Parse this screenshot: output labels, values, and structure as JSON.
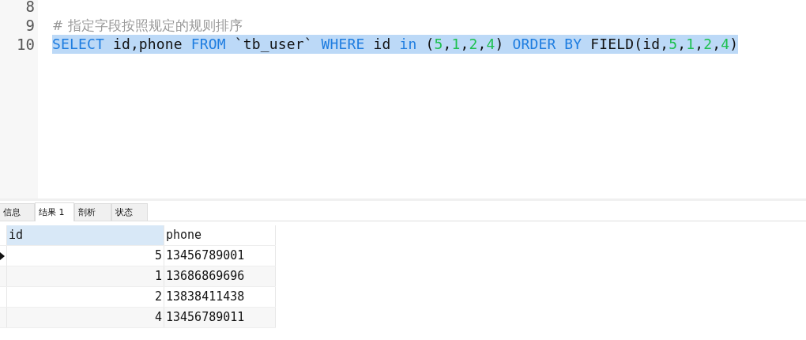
{
  "editor": {
    "lines": [
      {
        "number": "8",
        "selected": false
      },
      {
        "number": "9",
        "selected": false,
        "tokens": [
          {
            "kind": "comment",
            "text": "# 指定字段按照规定的规则排序"
          }
        ]
      },
      {
        "number": "10",
        "selected": true,
        "tokens": [
          {
            "kind": "keyword",
            "text": "SELECT"
          },
          {
            "kind": "plain",
            "text": " id,phone "
          },
          {
            "kind": "keyword",
            "text": "FROM"
          },
          {
            "kind": "plain",
            "text": " `tb_user` "
          },
          {
            "kind": "keyword",
            "text": "WHERE"
          },
          {
            "kind": "plain",
            "text": " id "
          },
          {
            "kind": "keyword",
            "text": "in"
          },
          {
            "kind": "plain",
            "text": " ("
          },
          {
            "kind": "number",
            "text": "5"
          },
          {
            "kind": "plain",
            "text": ","
          },
          {
            "kind": "number",
            "text": "1"
          },
          {
            "kind": "plain",
            "text": ","
          },
          {
            "kind": "number",
            "text": "2"
          },
          {
            "kind": "plain",
            "text": ","
          },
          {
            "kind": "number",
            "text": "4"
          },
          {
            "kind": "plain",
            "text": ") "
          },
          {
            "kind": "keyword",
            "text": "ORDER BY"
          },
          {
            "kind": "plain",
            "text": " FIELD(id,"
          },
          {
            "kind": "number",
            "text": "5"
          },
          {
            "kind": "plain",
            "text": ","
          },
          {
            "kind": "number",
            "text": "1"
          },
          {
            "kind": "plain",
            "text": ","
          },
          {
            "kind": "number",
            "text": "2"
          },
          {
            "kind": "plain",
            "text": ","
          },
          {
            "kind": "number",
            "text": "4"
          },
          {
            "kind": "plain",
            "text": ")"
          }
        ]
      }
    ]
  },
  "tabs": [
    {
      "label": "信息",
      "selected": false
    },
    {
      "label": "结果 1",
      "selected": true
    },
    {
      "label": "剖析",
      "selected": false
    },
    {
      "label": "状态",
      "selected": false
    }
  ],
  "table": {
    "columns": [
      {
        "label": "id",
        "selected": true
      },
      {
        "label": "phone",
        "selected": false
      }
    ],
    "rows": [
      {
        "current": true,
        "cells": [
          "5",
          "13456789001"
        ]
      },
      {
        "current": false,
        "cells": [
          "1",
          "13686869696"
        ]
      },
      {
        "current": false,
        "cells": [
          "2",
          "13838411438"
        ]
      },
      {
        "current": false,
        "cells": [
          "4",
          "13456789011"
        ]
      }
    ]
  }
}
